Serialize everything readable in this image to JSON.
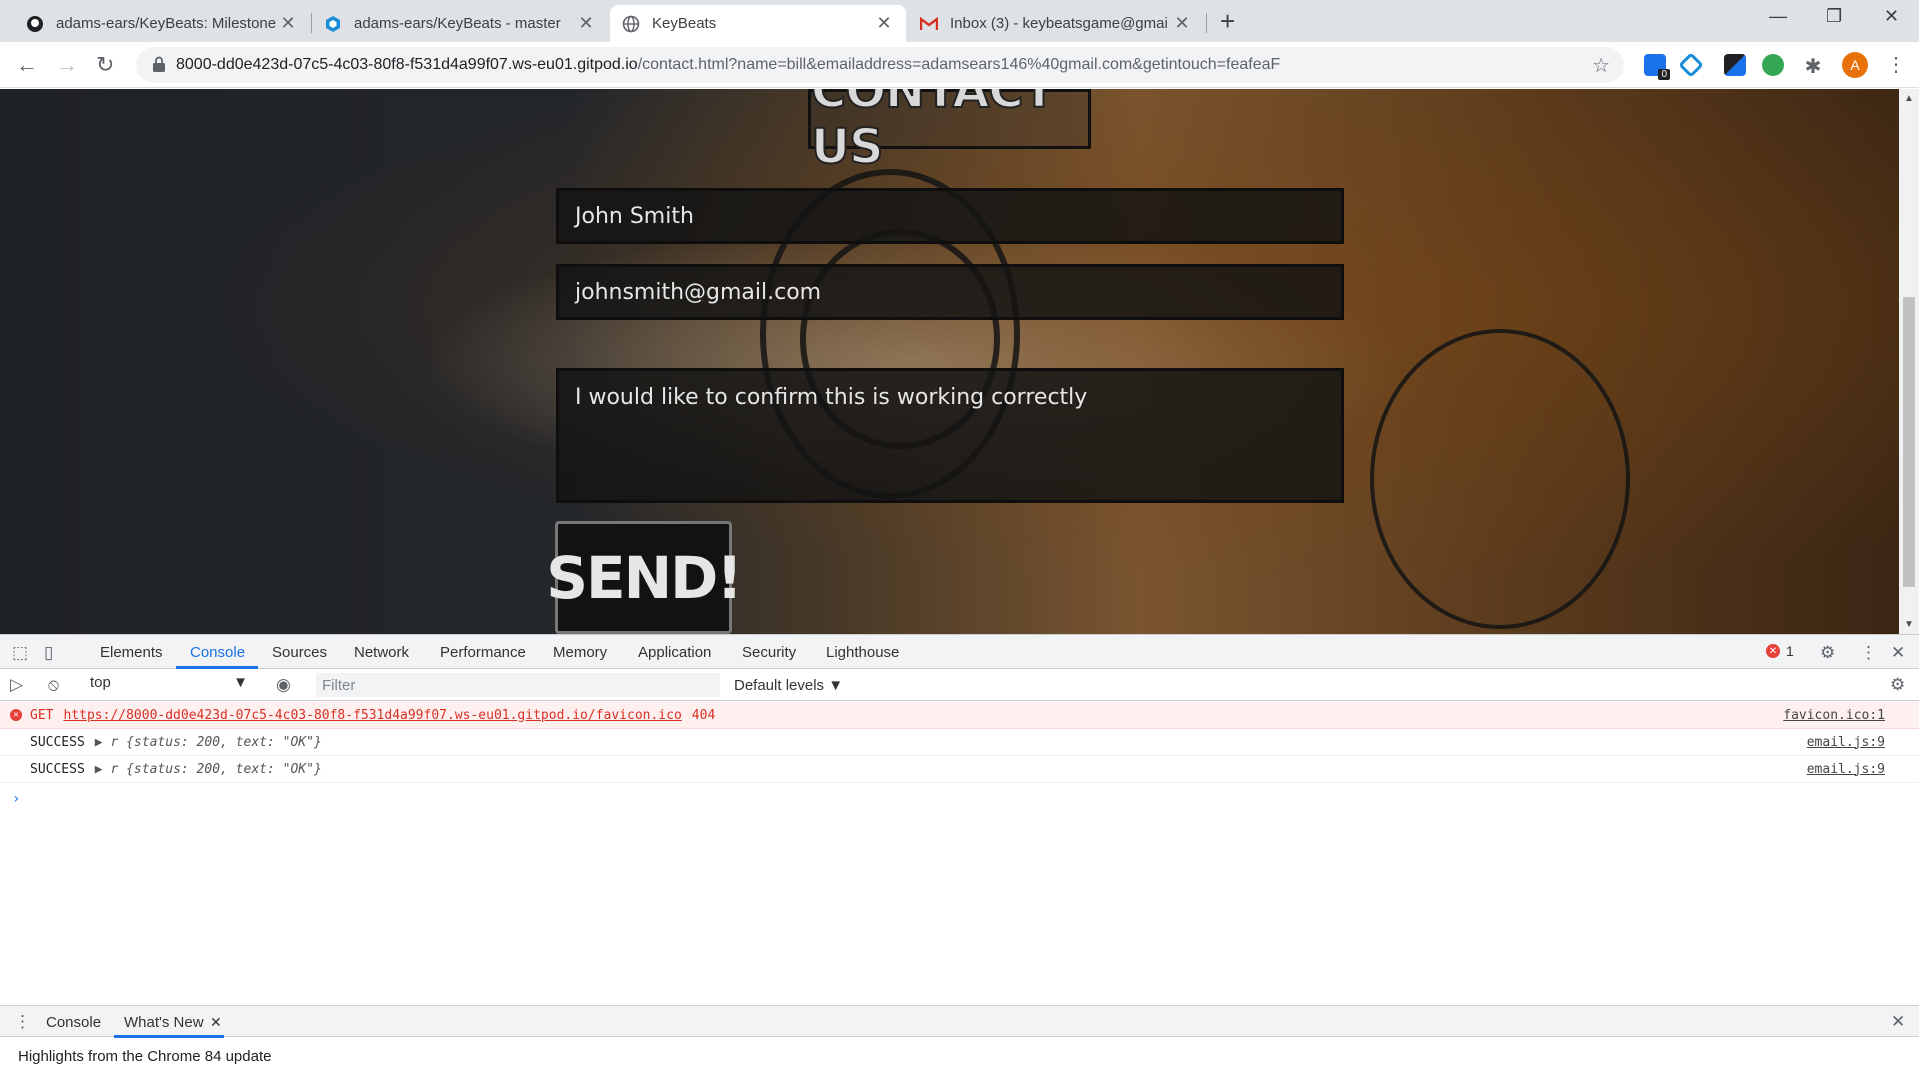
{
  "browser": {
    "tabs": [
      {
        "title": "adams-ears/KeyBeats: Milestone",
        "icon": "github-icon"
      },
      {
        "title": "adams-ears/KeyBeats - master",
        "icon": "gitpod-icon"
      },
      {
        "title": "KeyBeats",
        "icon": "globe-icon",
        "active": true
      },
      {
        "title": "Inbox (3) - keybeatsgame@gmai",
        "icon": "gmail-icon"
      }
    ],
    "url_domain": "8000-dd0e423d-07c5-4c03-80f8-f531d4a99f07.ws-eu01.gitpod.io",
    "url_path": "/contact.html?name=bill&emailaddress=adamsears146%40gmail.com&getintouch=feafeaF",
    "ext_badge": "0",
    "avatar_letter": "A"
  },
  "page": {
    "heading": "CONTACT US",
    "name_value": "John Smith",
    "email_value": "johnsmith@gmail.com",
    "message_value": "I would like to confirm this is working correctly",
    "send_label": "SEND!"
  },
  "devtools": {
    "tabs": [
      "Elements",
      "Console",
      "Sources",
      "Network",
      "Performance",
      "Memory",
      "Application",
      "Security",
      "Lighthouse"
    ],
    "active_tab": "Console",
    "error_count": "1",
    "context": "top",
    "filter_placeholder": "Filter",
    "levels": "Default levels ▼",
    "logs": [
      {
        "type": "error",
        "method": "GET",
        "url": "https://8000-dd0e423d-07c5-4c03-80f8-f531d4a99f07.ws-eu01.gitpod.io/favicon.ico",
        "code": "404",
        "source": "favicon.ico:1"
      },
      {
        "type": "log",
        "label": "SUCCESS",
        "object": "▶ r {status: 200, text: \"OK\"}",
        "source": "email.js:9"
      },
      {
        "type": "log",
        "label": "SUCCESS",
        "object": "▶ r {status: 200, text: \"OK\"}",
        "source": "email.js:9"
      }
    ],
    "drawer_tabs": [
      "Console",
      "What's New"
    ],
    "whats_new_text": "Highlights from the Chrome 84 update"
  }
}
